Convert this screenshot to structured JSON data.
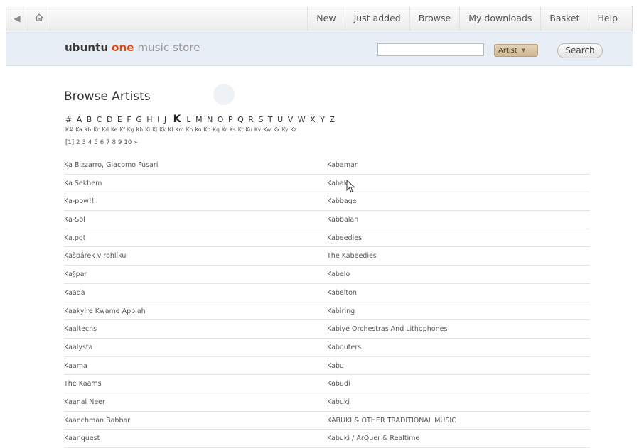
{
  "nav": {
    "back_icon": "chevron-left-icon",
    "home_icon": "home-icon",
    "links": [
      "New",
      "Just added",
      "Browse",
      "My downloads",
      "Basket",
      "Help"
    ]
  },
  "header": {
    "logo_part1": "ubuntu",
    "logo_part2": "one",
    "logo_part3": "music store",
    "search_value": "",
    "filter_selected": "Artist",
    "search_button": "Search"
  },
  "page": {
    "title": "Browse Artists",
    "letters": [
      "#",
      "A",
      "B",
      "C",
      "D",
      "E",
      "F",
      "G",
      "H",
      "I",
      "J",
      "K",
      "L",
      "M",
      "N",
      "O",
      "P",
      "Q",
      "R",
      "S",
      "T",
      "U",
      "V",
      "W",
      "X",
      "Y",
      "Z"
    ],
    "current_letter": "K",
    "subletters": [
      "K#",
      "Ka",
      "Kb",
      "Kc",
      "Kd",
      "Ke",
      "Kf",
      "Kg",
      "Kh",
      "Ki",
      "Kj",
      "Kk",
      "Kl",
      "Km",
      "Kn",
      "Ko",
      "Kp",
      "Kq",
      "Kr",
      "Ks",
      "Kt",
      "Ku",
      "Kv",
      "Kw",
      "Kx",
      "Ky",
      "Kz"
    ],
    "pages": [
      "[1]",
      "2",
      "3",
      "4",
      "5",
      "6",
      "7",
      "8",
      "9",
      "10",
      "»"
    ]
  },
  "artists_left": [
    "Ka Bizzarro, Giacomo Fusari",
    "Ka Sekhem",
    "Ka-pow!!",
    "Ka-Sol",
    "Ka.pot",
    "Kašpárek v rohlíku",
    "Ka§par",
    "Kaada",
    "Kaakyire Kwame Appiah",
    "Kaaltechs",
    "Kaalysta",
    "Kaama",
    "The Kaams",
    "Kaanal Neer",
    "Kaanchman Babbar",
    "Kaanquest"
  ],
  "artists_right": [
    "Kabaman",
    "Kabak",
    "Kabbage",
    "Kabbalah",
    "Kabeedies",
    "The Kabeedies",
    "Kabelo",
    "Kabelton",
    "Kabiring",
    "Kabiyé Orchestras And Lithophones",
    "Kabouters",
    "Kabu",
    "Kabudi",
    "Kabuki",
    "KABUKI & OTHER TRADITIONAL MUSIC",
    "Kabuki / ArQuer & Realtime"
  ]
}
